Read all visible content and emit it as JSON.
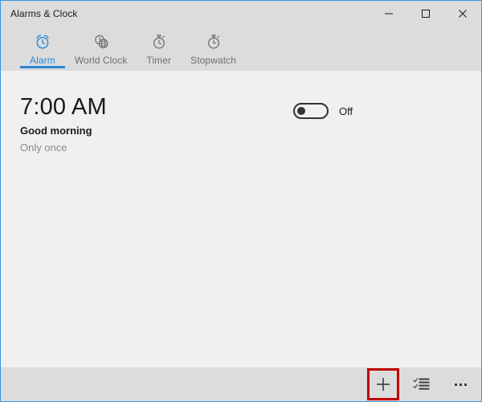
{
  "window": {
    "title": "Alarms & Clock",
    "accent_border_color": "#3a96dd",
    "chrome_color": "#dcdcdc",
    "content_color": "#f0f0f0",
    "controls": [
      {
        "name": "minimize",
        "icon": "minimize-icon",
        "label": "Minimize"
      },
      {
        "name": "maximize",
        "icon": "maximize-icon",
        "label": "Maximize"
      },
      {
        "name": "close",
        "icon": "close-icon",
        "label": "Close"
      }
    ]
  },
  "tabs": {
    "active_index": 0,
    "accent_color": "#2b88d8",
    "items": [
      {
        "label": "Alarm",
        "icon": "alarm-clock-icon"
      },
      {
        "label": "World Clock",
        "icon": "world-clock-icon"
      },
      {
        "label": "Timer",
        "icon": "timer-icon"
      },
      {
        "label": "Stopwatch",
        "icon": "stopwatch-icon"
      }
    ]
  },
  "alarms": [
    {
      "time": "7:00 AM",
      "name": "Good morning",
      "repeat": "Only once",
      "toggle_state": "Off",
      "toggle_on": false
    }
  ],
  "commandbar": {
    "buttons": [
      {
        "name": "add-alarm",
        "icon": "plus-icon",
        "label": "Add new alarm",
        "highlighted": true,
        "highlight_color": "#c00000"
      },
      {
        "name": "select-alarms",
        "icon": "select-checklist-icon",
        "label": "Select",
        "highlighted": false
      },
      {
        "name": "more-options",
        "icon": "ellipsis-icon",
        "label": "See more",
        "highlighted": false
      }
    ]
  }
}
